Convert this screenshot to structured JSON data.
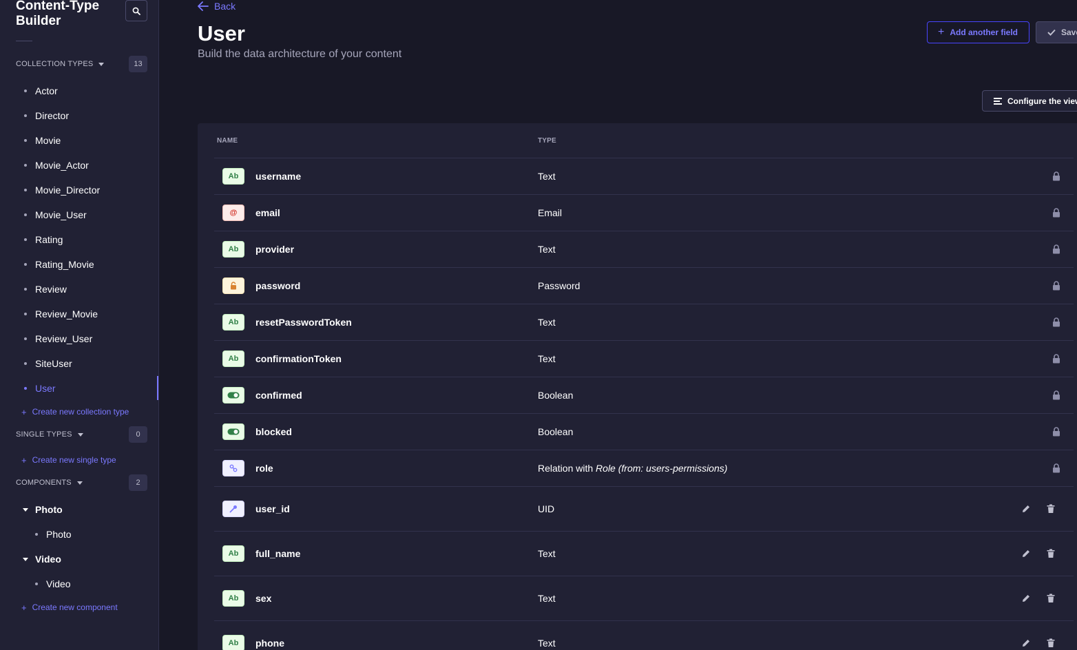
{
  "sidebar": {
    "title": "Content-Type Builder",
    "collection_types": {
      "label": "Collection Types",
      "count": "13",
      "items": [
        "Actor",
        "Director",
        "Movie",
        "Movie_Actor",
        "Movie_Director",
        "Movie_User",
        "Rating",
        "Rating_Movie",
        "Review",
        "Review_Movie",
        "Review_User",
        "SiteUser",
        "User"
      ],
      "active": "User",
      "create_label": "Create new collection type"
    },
    "single_types": {
      "label": "Single Types",
      "count": "0",
      "create_label": "Create new single type"
    },
    "components": {
      "label": "Components",
      "count": "2",
      "groups": [
        {
          "name": "Photo",
          "items": [
            "Photo"
          ]
        },
        {
          "name": "Video",
          "items": [
            "Video"
          ]
        }
      ],
      "create_label": "Create new component"
    }
  },
  "header": {
    "back_label": "Back",
    "title": "User",
    "subtitle": "Build the data architecture of your content",
    "add_field_label": "Add another field",
    "save_label": "Save",
    "configure_label": "Configure the view"
  },
  "table": {
    "columns": {
      "name": "Name",
      "type": "Type"
    },
    "rows": [
      {
        "icon": "Ab",
        "kind": "text",
        "name": "username",
        "type": "Text",
        "locked": true
      },
      {
        "icon": "@",
        "kind": "email",
        "name": "email",
        "type": "Email",
        "locked": true
      },
      {
        "icon": "Ab",
        "kind": "text",
        "name": "provider",
        "type": "Text",
        "locked": true
      },
      {
        "icon": "lock",
        "kind": "password",
        "name": "password",
        "type": "Password",
        "locked": true
      },
      {
        "icon": "Ab",
        "kind": "text",
        "name": "resetPasswordToken",
        "type": "Text",
        "locked": true
      },
      {
        "icon": "Ab",
        "kind": "text",
        "name": "confirmationToken",
        "type": "Text",
        "locked": true
      },
      {
        "icon": "toggle",
        "kind": "boolean",
        "name": "confirmed",
        "type": "Boolean",
        "locked": true
      },
      {
        "icon": "toggle",
        "kind": "boolean",
        "name": "blocked",
        "type": "Boolean",
        "locked": true
      },
      {
        "icon": "link",
        "kind": "relation",
        "name": "role",
        "type_prefix": "Relation with ",
        "type_italic": "Role (from: users-permissions)",
        "locked": true
      },
      {
        "icon": "key",
        "kind": "uid",
        "name": "user_id",
        "type": "UID",
        "locked": false
      },
      {
        "icon": "Ab",
        "kind": "text",
        "name": "full_name",
        "type": "Text",
        "locked": false
      },
      {
        "icon": "Ab",
        "kind": "text",
        "name": "sex",
        "type": "Text",
        "locked": false
      },
      {
        "icon": "Ab",
        "kind": "text",
        "name": "phone",
        "type": "Text",
        "locked": false
      }
    ]
  },
  "colors": {
    "accent": "#7b79ff",
    "primary": "#4945ff",
    "background": "#181826",
    "panel": "#212134"
  }
}
